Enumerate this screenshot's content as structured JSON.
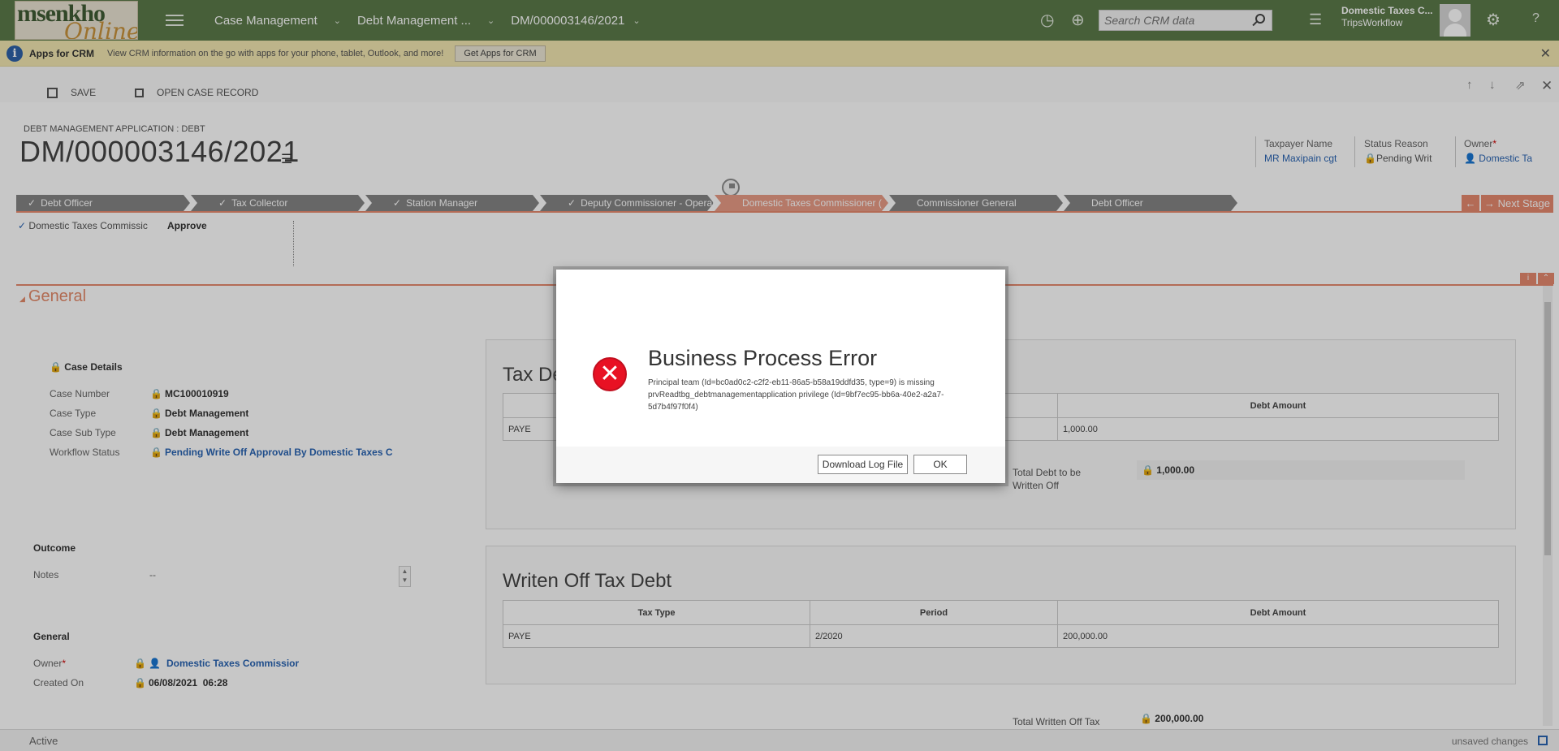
{
  "nav": {
    "logo_text_1": "msenkho",
    "logo_text_2": "Online",
    "crumb_1": "Case Management",
    "crumb_2": "Debt Management ...",
    "crumb_3": "DM/000003146/2021",
    "search_placeholder": "Search CRM data",
    "user_name": "Domestic Taxes C...",
    "user_org": "TripsWorkflow",
    "help": "?"
  },
  "notification": {
    "title": "Apps for CRM",
    "message": "View CRM information on the go with apps for your phone, tablet, Outlook, and more!",
    "button": "Get Apps for CRM"
  },
  "commands": {
    "save": "SAVE",
    "open_case": "OPEN CASE RECORD"
  },
  "header": {
    "entity_type": "DEBT MANAGEMENT APPLICATION : DEBT",
    "record_title": "DM/000003146/2021",
    "taxpayer_label": "Taxpayer Name",
    "taxpayer_value": "MR Maxipain cgt",
    "status_label": "Status Reason",
    "status_value": "Pending Writ",
    "owner_label": "Owner",
    "owner_value": "Domestic Ta"
  },
  "process": {
    "stages": [
      "Debt Officer",
      "Tax Collector",
      "Station Manager",
      "Deputy Commissioner - Operati",
      "Domestic Taxes Commissioner (",
      "Commissioner General",
      "Debt Officer"
    ],
    "next_stage": "Next Stage",
    "step_label": "Domestic Taxes Commissic",
    "step_value": "Approve"
  },
  "general": {
    "section_title": "General",
    "case_details_title": "Case Details",
    "case_number_label": "Case Number",
    "case_number": "MC100010919",
    "case_type_label": "Case Type",
    "case_type": "Debt Management",
    "case_sub_type_label": "Case Sub Type",
    "case_sub_type": "Debt Management",
    "workflow_status_label": "Workflow Status",
    "workflow_status": "Pending Write Off Approval By Domestic Taxes C",
    "outcome_title": "Outcome",
    "notes_label": "Notes",
    "notes_value": "--",
    "general_title": "General",
    "owner_label": "Owner",
    "owner_value": "Domestic Taxes Commissior",
    "created_on_label": "Created On",
    "created_on_value": "06/08/2021  06:28"
  },
  "tax_debt": {
    "title": "Tax De",
    "amount_header": "Debt Amount",
    "row_tax_type": "PAYE",
    "row_amount": "1,000.00",
    "total_label": "Total Debt to be Written Off",
    "total_value": "1,000.00"
  },
  "written_off": {
    "title": "Writen Off Tax Debt",
    "headers": [
      "Tax Type",
      "Period",
      "Debt Amount"
    ],
    "row": [
      "PAYE",
      "2/2020",
      "200,000.00"
    ],
    "total_label": "Total Written Off Tax",
    "total_value": "200,000.00"
  },
  "footer": {
    "status": "Active",
    "unsaved": "unsaved changes"
  },
  "dialog": {
    "title": "Business Process Error",
    "message": "Principal team (Id=bc0ad0c2-c2f2-eb11-86a5-b58a19ddfd35, type=9) is missing prvReadtbg_debtmanagementapplication privilege (Id=9bf7ec95-bb6a-40e2-a2a7-5d7b4f97f0f4)",
    "download_button": "Download Log File",
    "ok_button": "OK"
  }
}
